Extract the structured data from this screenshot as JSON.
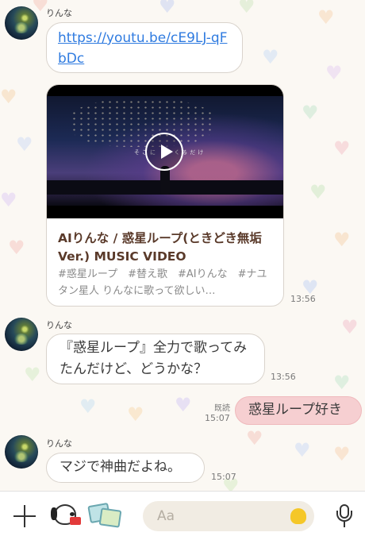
{
  "messages": [
    {
      "type": "text",
      "sender": "りんな",
      "text": "https://youtu.be/cE9LJ-qFbDc",
      "link": true
    },
    {
      "type": "video_card",
      "title": "AIりんな / 惑星ループ(ときどき無垢 Ver.) MUSIC VIDEO",
      "description": "#惑星ループ　#替え歌　#AIりんな　#ナユタン星人 りんなに歌って欲しい…",
      "thumbnail_caption": "そこに い   くるだけ",
      "time": "13:56"
    },
    {
      "type": "text",
      "sender": "りんな",
      "text": "『惑星ループ』全力で歌ってみたんだけど、どうかな？",
      "time": "13:56"
    },
    {
      "type": "mine",
      "text": "惑星ループ好き",
      "read": "既読",
      "time": "15:07"
    },
    {
      "type": "text",
      "sender": "りんな",
      "text": "マジで神曲だよね。",
      "time": "15:07"
    }
  ],
  "composer": {
    "placeholder": "Aa"
  },
  "icons": [
    "plus-icon",
    "sticker-snoopy-icon",
    "photo-icon",
    "emoji-woodstock-icon",
    "microphone-icon"
  ],
  "colors": {
    "link": "#2f7be0",
    "mine_bubble": "#f6cfd1",
    "title": "#5a3a2a"
  }
}
